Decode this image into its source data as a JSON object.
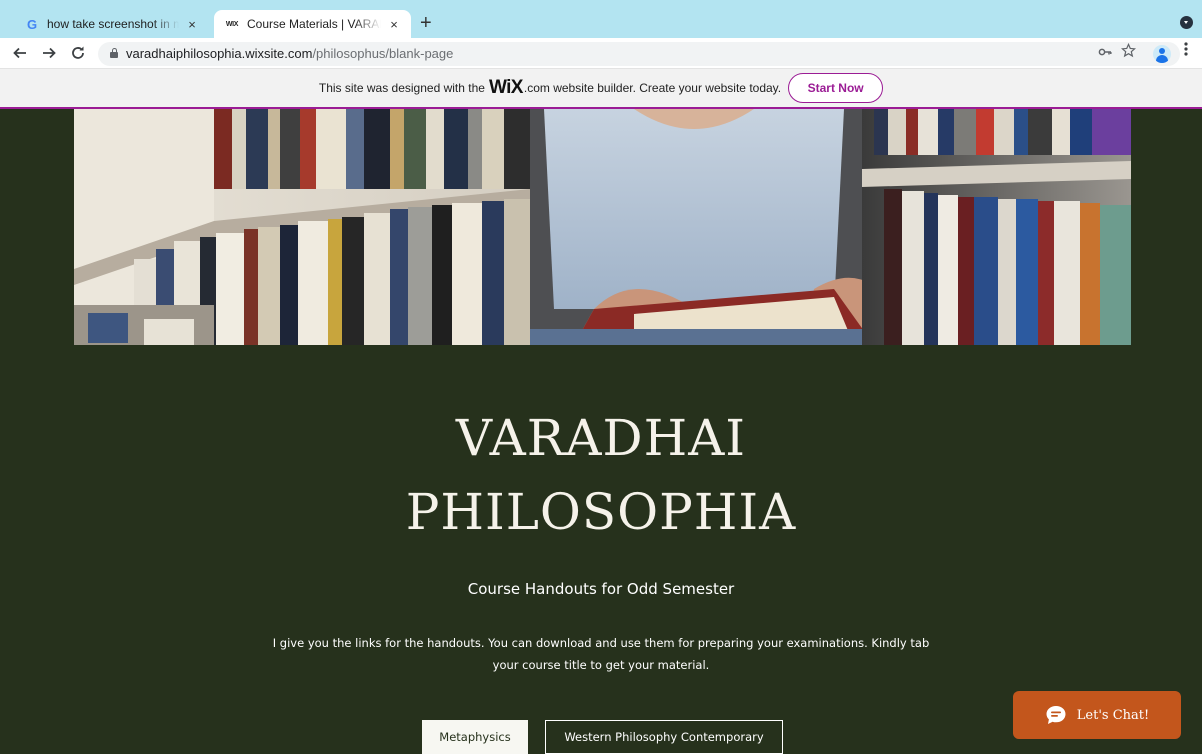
{
  "browser": {
    "tabs": [
      {
        "title": "how take screenshot in macbook",
        "favicon": "G",
        "active": false,
        "close": "×"
      },
      {
        "title": "Course Materials | VARADHAI PHILOSOPHIA",
        "favicon": "WIX",
        "active": true,
        "close": "×"
      }
    ],
    "new_tab": "+",
    "address": {
      "host": "varadhaiphilosophia.wixsite.com",
      "path": "/philosophus/blank-page"
    },
    "icons": [
      "back-arrow-icon",
      "forward-arrow-icon",
      "reload-icon",
      "lock-icon",
      "key-icon",
      "star-icon",
      "profile-icon",
      "menu-icon"
    ]
  },
  "wix_banner": {
    "text_before": "This site was designed with the",
    "logo": "WiX",
    "text_after": ".com website builder. Create your website today.",
    "button": "Start Now",
    "accent": "#9b1c95"
  },
  "site": {
    "title_line1": "VARADHAI",
    "title_line2": "PHILOSOPHIA",
    "subtitle": "Course Handouts for Odd Semester",
    "intro": "I give you the links for the handouts. You can download and use them for preparing your examinations. Kindly tab your course title to get your material.",
    "courses": [
      "Metaphysics",
      "Western Philosophy Contemporary"
    ],
    "background": "#26311c"
  },
  "chat": {
    "label": "Let's Chat!",
    "color": "#c3561c"
  }
}
